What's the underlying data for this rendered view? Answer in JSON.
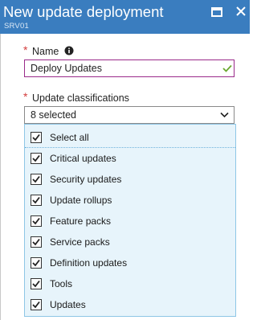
{
  "header": {
    "title": "New update deployment",
    "subtitle": "SRV01",
    "background_color": "#3a7dbf",
    "maximize_icon": "maximize-icon",
    "close_icon": "close-icon"
  },
  "name_field": {
    "required_marker": "*",
    "label": "Name",
    "info_icon": "info-icon",
    "value": "Deploy Updates",
    "valid_icon": "check-icon",
    "border_color": "#9a2a8a"
  },
  "update_classifications": {
    "required_marker": "*",
    "label": "Update classifications",
    "selected_text": "8 selected",
    "dropdown_icon": "chevron-down-icon",
    "options": [
      {
        "label": "Select all",
        "checked": true
      },
      {
        "label": "Critical updates",
        "checked": true
      },
      {
        "label": "Security updates",
        "checked": true
      },
      {
        "label": "Update rollups",
        "checked": true
      },
      {
        "label": "Feature packs",
        "checked": true
      },
      {
        "label": "Service packs",
        "checked": true
      },
      {
        "label": "Definition updates",
        "checked": true
      },
      {
        "label": "Tools",
        "checked": true
      },
      {
        "label": "Updates",
        "checked": true
      }
    ]
  },
  "colors": {
    "required": "#d33c3c",
    "dropdown_background": "#e7f4fb",
    "valid_check": "#6aa82f"
  }
}
